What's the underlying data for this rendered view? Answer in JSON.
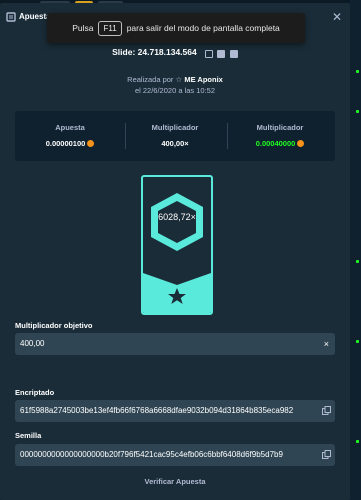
{
  "modal": {
    "title": "Apuesta",
    "close_icon": "close-icon"
  },
  "fullscreen_toast": {
    "prefix": "Pulsa",
    "key": "F11",
    "suffix": "para salir del modo de pantalla completa"
  },
  "bet": {
    "slide_text": "Slide: 24.718.134.564",
    "made_by_prefix": "Realizada por",
    "user": "ME Aponix",
    "date": "el 22/6/2020 a las 10:52"
  },
  "stats": [
    {
      "label": "Apuesta",
      "value": "0.00000100",
      "coin": true,
      "color": "#ffffff"
    },
    {
      "label": "Multiplicador",
      "value": "400,00×",
      "coin": false,
      "color": "#ffffff"
    },
    {
      "label": "Multiplicador",
      "value": "0.00040000",
      "coin": true,
      "color": "#1fff20"
    }
  ],
  "card": {
    "multiplier": "6028,72×",
    "accent": "#5aeadb"
  },
  "target": {
    "label": "Multiplicador objetivo",
    "value": "400,00",
    "clear": "×"
  },
  "encrypted": {
    "label": "Encriptado",
    "value": "61f5988a2745003be13ef4fb66f6768a6668dfae9032b094d31864b835eca982"
  },
  "seed": {
    "label": "Semilla",
    "value": "0000000000000000000b20f796f5421cac95c4efb06c6bbf6408d6f9b5d7b9"
  },
  "verify_label": "Verificar Apuesta"
}
